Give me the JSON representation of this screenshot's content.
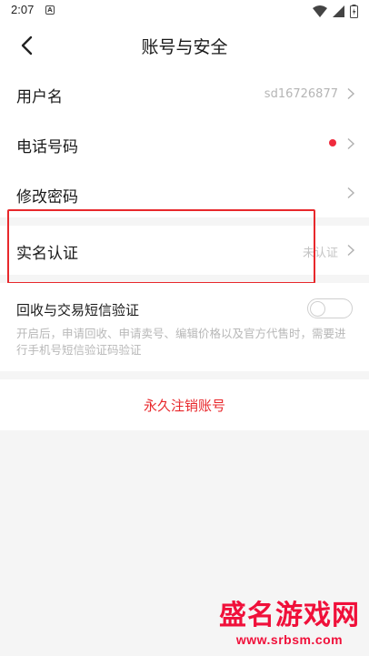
{
  "status_bar": {
    "time": "2:07",
    "notif_icon": "A"
  },
  "header": {
    "title": "账号与安全"
  },
  "rows": {
    "username": {
      "label": "用户名",
      "value": "sd16726877"
    },
    "phone": {
      "label": "电话号码"
    },
    "password": {
      "label": "修改密码"
    },
    "realname": {
      "label": "实名认证",
      "value": "未认证"
    }
  },
  "sms_verify": {
    "label": "回收与交易短信验证",
    "enabled": false,
    "description": "开启后，申请回收、申请卖号、编辑价格以及官方代售时，需要进行手机号短信验证码验证"
  },
  "delete_account": {
    "label": "永久注销账号"
  },
  "watermark": {
    "title": "盛名游戏网",
    "url": "www.srbsm.com"
  },
  "colors": {
    "accent_red": "#e8282c",
    "dot_red": "#ef2b3d",
    "muted": "#b5b5b5"
  }
}
